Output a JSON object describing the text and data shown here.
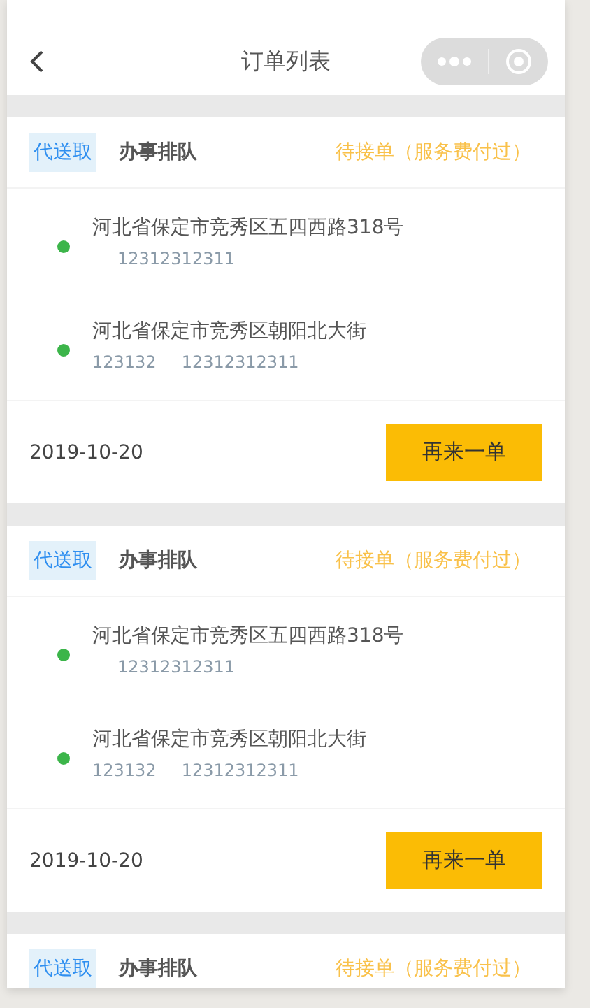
{
  "nav": {
    "title": "订单列表"
  },
  "orders": [
    {
      "tag": "代送取",
      "service": "办事排队",
      "status": "待接单（服务费付过）",
      "addresses": [
        {
          "address": "河北省保定市竞秀区五四西路318号",
          "phone": "12312312311"
        },
        {
          "address": "河北省保定市竞秀区朝阳北大街",
          "name": "123132",
          "phone": "12312312311"
        }
      ],
      "date": "2019-10-20",
      "action": "再来一单"
    },
    {
      "tag": "代送取",
      "service": "办事排队",
      "status": "待接单（服务费付过）",
      "addresses": [
        {
          "address": "河北省保定市竞秀区五四西路318号",
          "phone": "12312312311"
        },
        {
          "address": "河北省保定市竞秀区朝阳北大街",
          "name": "123132",
          "phone": "12312312311"
        }
      ],
      "date": "2019-10-20",
      "action": "再来一单"
    },
    {
      "tag": "代送取",
      "service": "办事排队",
      "status": "待接单（服务费付过）"
    }
  ]
}
